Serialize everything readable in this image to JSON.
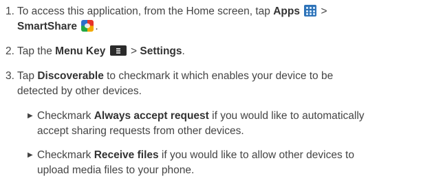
{
  "steps": [
    {
      "number": "1.",
      "line1_pre": "To access this application, from the Home screen, tap ",
      "apps": "Apps",
      "gt1": " >",
      "smartshare": "SmartShare",
      "end": "."
    },
    {
      "number": "2.",
      "pre": "Tap the ",
      "menu_key": "Menu Key",
      "mid": " > ",
      "settings": "Settings",
      "end": "."
    },
    {
      "number": "3.",
      "pre": "Tap ",
      "discoverable": "Discoverable",
      "line1_post": " to checkmark it which enables your device to be",
      "line2": "detected by other devices."
    }
  ],
  "bullets": [
    {
      "marker": "▶",
      "pre": "Checkmark ",
      "bold": "Always accept request",
      "line1_post": " if you would like to automatically",
      "line2": "accept sharing requests from other devices."
    },
    {
      "marker": "▶",
      "pre": "Checkmark ",
      "bold": "Receive files",
      "line1_post": " if you would like to allow other devices to",
      "line2": "upload media files to your phone."
    }
  ],
  "icons": {
    "apps": "apps-grid-icon",
    "smartshare": "smartshare-icon",
    "menu": "menu-key-icon"
  }
}
